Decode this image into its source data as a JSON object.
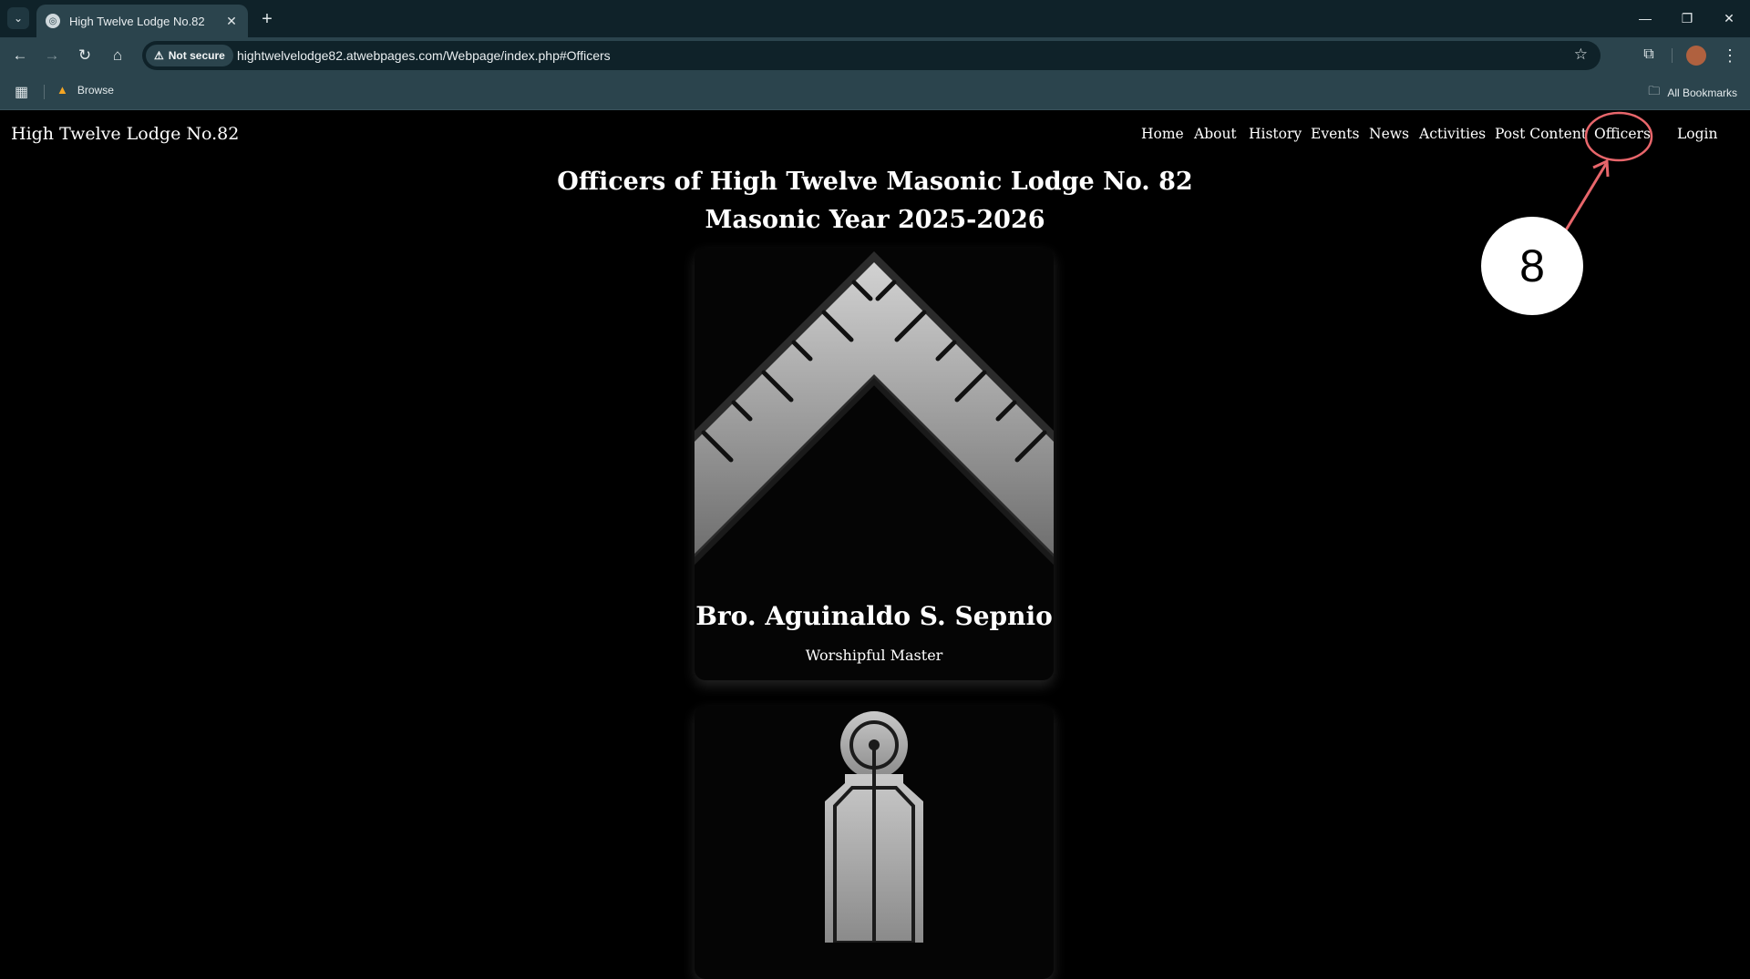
{
  "browser": {
    "tab_title": "High Twelve Lodge No.82",
    "security_label": "Not secure",
    "url": "hightwelvelodge82.atwebpages.com/Webpage/index.php#Officers",
    "bookmark_item": "Browse",
    "all_bookmarks": "All Bookmarks"
  },
  "site": {
    "title": "High Twelve Lodge No.82",
    "nav": [
      "Home",
      "About",
      "History",
      "Events",
      "News",
      "Activities",
      "Post Content",
      "Officers",
      "Login"
    ]
  },
  "page": {
    "heading_line1": "Officers of High Twelve Masonic Lodge No. 82",
    "heading_line2": "Masonic Year 2025-2026"
  },
  "officers": [
    {
      "name": "Bro. Aguinaldo S. Sepnio",
      "role": "Worshipful Master",
      "emblem": "square-emblem-icon"
    }
  ],
  "annotation": {
    "number": "8",
    "color": "#e8666b"
  }
}
